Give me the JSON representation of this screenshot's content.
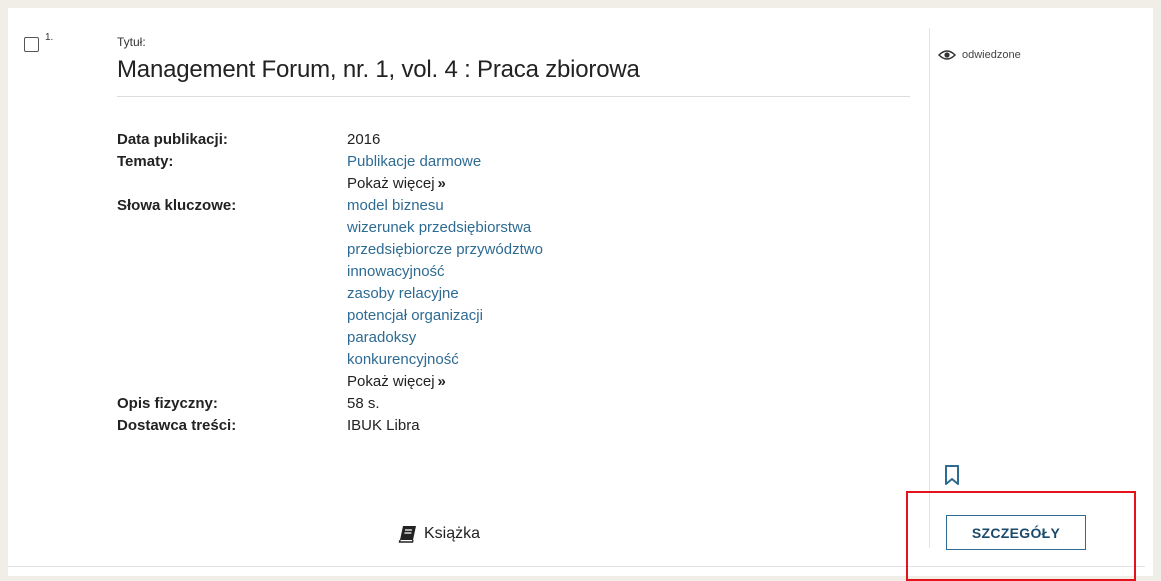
{
  "record": {
    "number": "1.",
    "title_label": "Tytuł:",
    "title": "Management Forum, nr. 1, vol. 4 : Praca zbiorowa",
    "fields": {
      "pub_date_label": "Data publikacji:",
      "pub_date": "2016",
      "subjects_label": "Tematy:",
      "subjects": [
        "Publikacje darmowe"
      ],
      "keywords_label": "Słowa kluczowe:",
      "keywords": [
        "model biznesu",
        "wizerunek przedsiębiorstwa",
        "przedsiębiorcze przywództwo",
        "innowacyjność",
        "zasoby relacyjne",
        "potencjał organizacji",
        "paradoksy",
        "konkurencyjność"
      ],
      "show_more": "Pokaż więcej",
      "physical_label": "Opis fizyczny:",
      "physical": "58 s.",
      "provider_label": "Dostawca treści:",
      "provider": "IBUK Libra"
    },
    "format": {
      "icon": "book-icon",
      "label": "Książka"
    },
    "visited": {
      "icon": "eye-icon",
      "label": "odwiedzone"
    },
    "bookmark_icon": "bookmark-icon",
    "details_button": "SZCZEGÓŁY"
  },
  "colors": {
    "link": "#2e6b93",
    "highlight": "#e3121b",
    "background": "#f0eee6"
  }
}
